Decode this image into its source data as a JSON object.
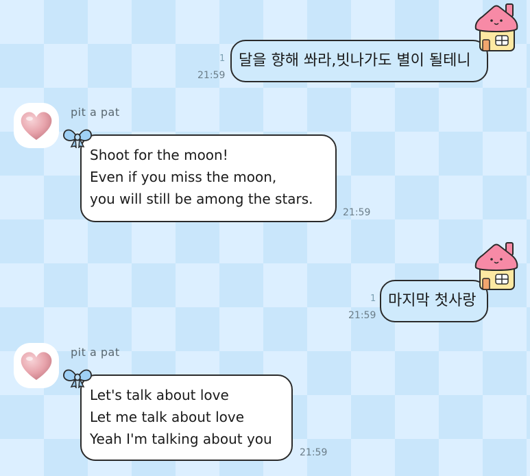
{
  "colors": {
    "sent_bubble": "#cfeafc",
    "received_bubble": "#ffffff",
    "bow": "#9fd0f5",
    "house_roof": "#f78aa6",
    "house_wall": "#fde9a3",
    "heart": "#e7a3ab"
  },
  "messages": [
    {
      "direction": "sent",
      "text": "달을 향해 쏴라,빗나가도 별이 될테니",
      "time": "21:59",
      "unread": "1",
      "avatar_icon": "pink-house-icon"
    },
    {
      "direction": "received",
      "sender": "pit a pat",
      "avatar_icon": "heart-icon",
      "decoration_icon": "blue-bow-icon",
      "lines": [
        "Shoot for the moon!",
        "Even if you miss the moon,",
        "you will still be among the stars."
      ],
      "time": "21:59"
    },
    {
      "direction": "sent",
      "text": "마지막 첫사랑",
      "time": "21:59",
      "unread": "1",
      "avatar_icon": "pink-house-icon"
    },
    {
      "direction": "received",
      "sender": "pit a pat",
      "avatar_icon": "heart-icon",
      "decoration_icon": "blue-bow-icon",
      "lines": [
        "Let's talk about love",
        "Let me talk about love",
        "Yeah I'm talking about you"
      ],
      "time": "21:59"
    }
  ]
}
